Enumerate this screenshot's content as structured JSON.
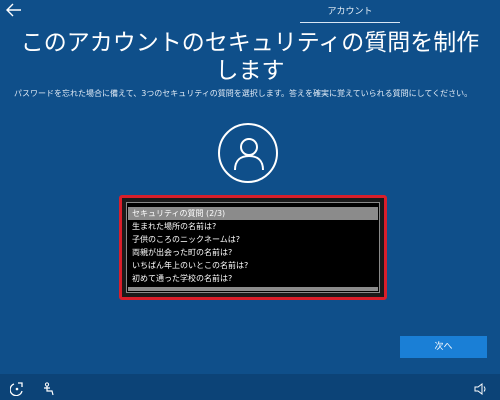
{
  "header": {
    "back_icon": "back-arrow-icon",
    "tab_label": "アカウント"
  },
  "main": {
    "title": "このアカウントのセキュリティの質問を制作します",
    "description": "パスワードを忘れた場合に備えて、3つのセキュリティの質問を選択します。答えを確実に覚えていられる質問にしてください。",
    "avatar_icon": "user-avatar-icon",
    "question_list": {
      "selected": "セキュリティの質問 (2/3)",
      "options": [
        "セキュリティの質問 (2/3)",
        "生まれた場所の名前は?",
        "子供のころのニックネームは?",
        "両親が出会った町の名前は?",
        "いちばん年上のいとこの名前は?",
        "初めて通った学校の名前は?"
      ]
    },
    "next_label": "次へ"
  },
  "footer": {
    "icons": [
      "ease-of-access-icon",
      "accessibility-person-icon",
      "volume-icon"
    ]
  },
  "colors": {
    "background": "#0f4f8a",
    "highlight_border": "#d91e2a",
    "button": "#1a7fd6",
    "selected_row": "#8b8b8b"
  }
}
